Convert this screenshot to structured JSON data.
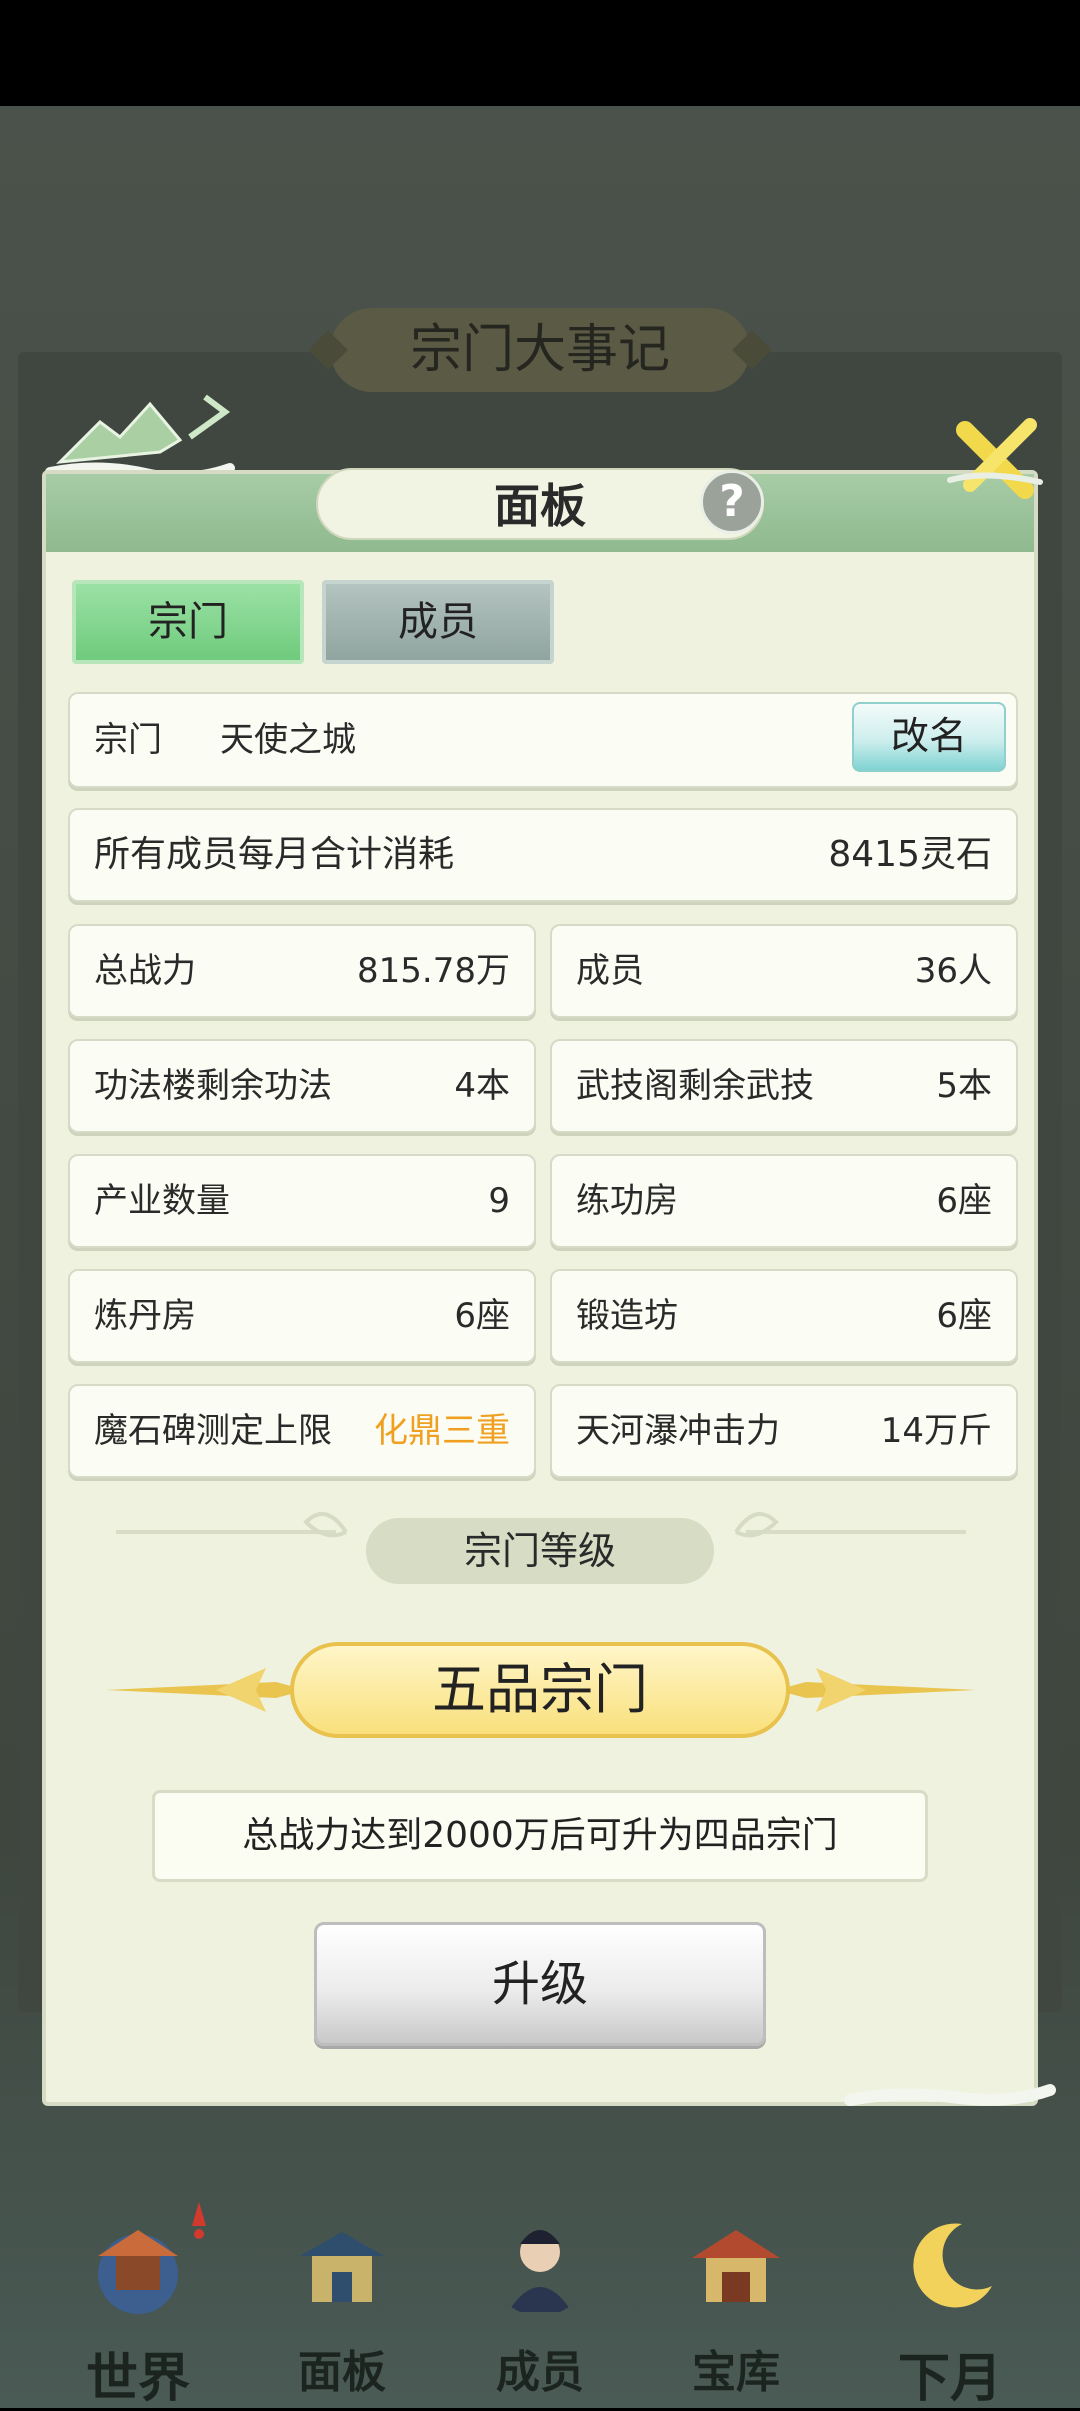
{
  "background": {
    "title": "宗门大事记"
  },
  "dialog": {
    "title": "面板",
    "help_icon": "?",
    "tabs": [
      {
        "label": "宗门",
        "active": true
      },
      {
        "label": "成员",
        "active": false
      }
    ],
    "sect": {
      "label": "宗门",
      "name": "天使之城",
      "rename_label": "改名"
    },
    "monthly_cost": {
      "label": "所有成员每月合计消耗",
      "value": "8415灵石"
    },
    "stats": [
      {
        "label": "总战力",
        "value": "815.78万"
      },
      {
        "label": "成员",
        "value": "36人"
      },
      {
        "label": "功法楼剩余功法",
        "value": "4本"
      },
      {
        "label": "武技阁剩余武技",
        "value": "5本"
      },
      {
        "label": "产业数量",
        "value": "9"
      },
      {
        "label": "练功房",
        "value": "6座"
      },
      {
        "label": "炼丹房",
        "value": "6座"
      },
      {
        "label": "锻造坊",
        "value": "6座"
      },
      {
        "label": "魔石碑测定上限",
        "value": "化鼎三重"
      },
      {
        "label": "天河瀑冲击力",
        "value": "14万斤"
      }
    ],
    "level_section": {
      "title": "宗门等级",
      "grade": "五品宗门",
      "note": "总战力达到2000万后可升为四品宗门",
      "upgrade_label": "升级"
    }
  },
  "bottom_nav": [
    {
      "label": "世界",
      "icon": "temple-icon"
    },
    {
      "label": "面板",
      "icon": "gate-icon"
    },
    {
      "label": "成员",
      "icon": "disciple-icon"
    },
    {
      "label": "宝库",
      "icon": "treasury-icon"
    },
    {
      "label": "下月",
      "icon": "moon-icon"
    }
  ],
  "colors": {
    "highlight_value": "#f0a020",
    "header_green": "#8fb98f",
    "panel_bg": "#eef2df"
  }
}
